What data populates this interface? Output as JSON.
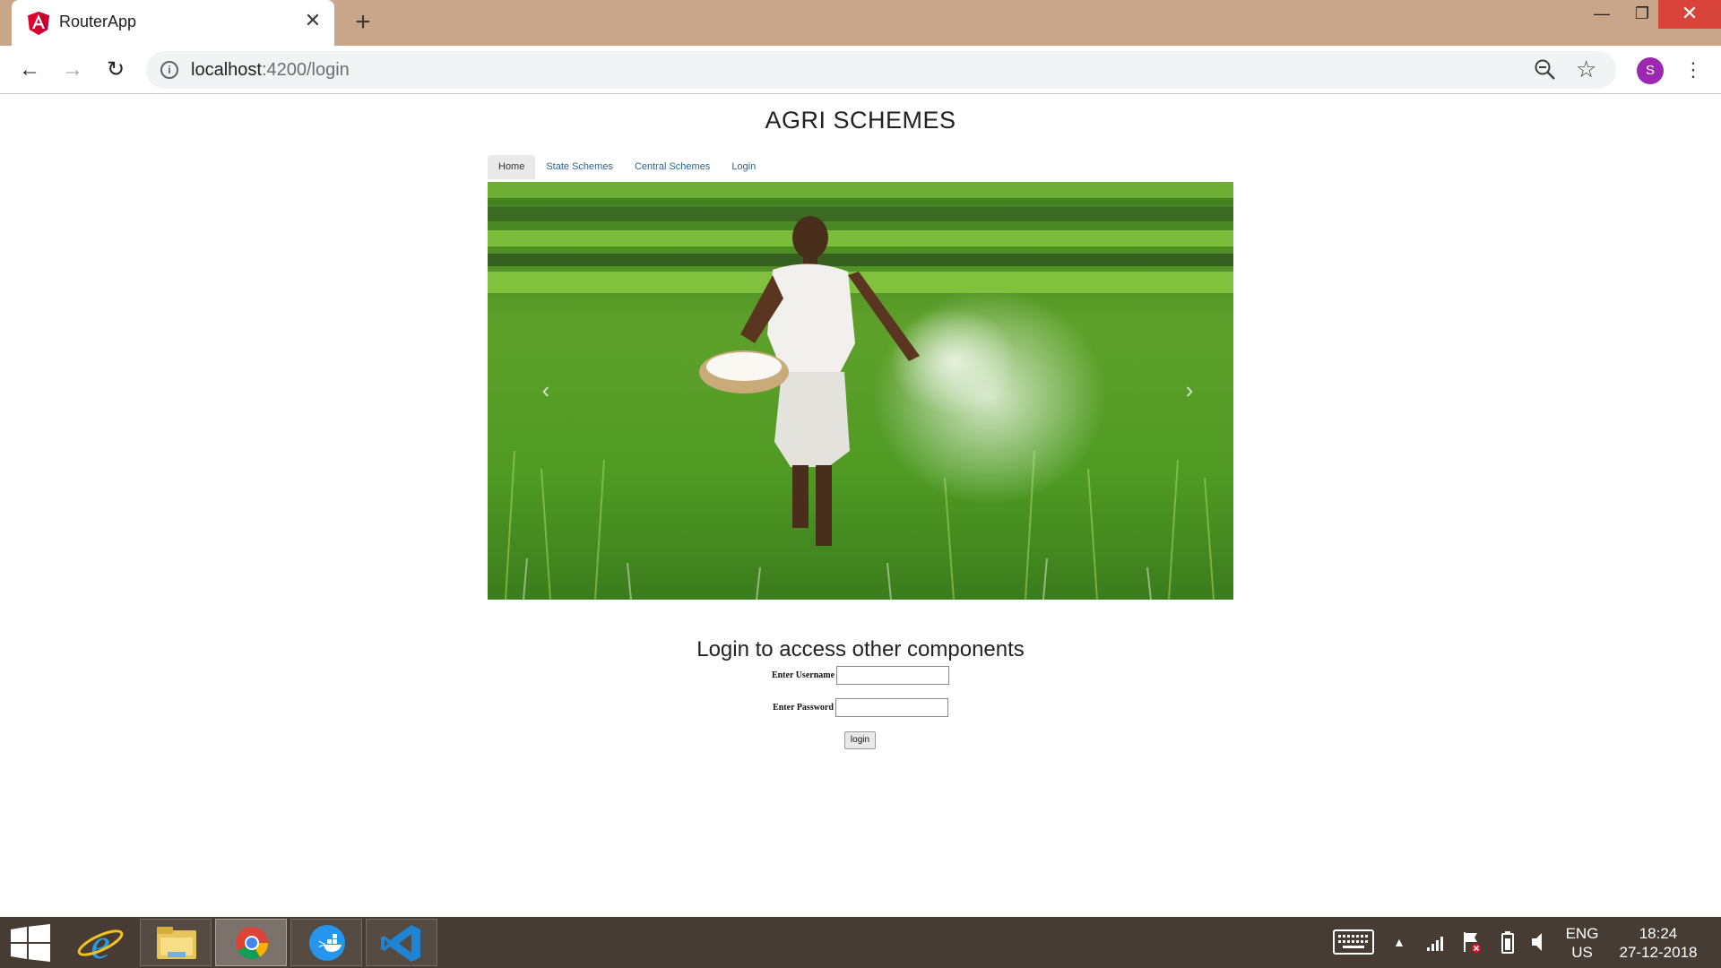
{
  "browser": {
    "tab_title": "RouterApp",
    "url_host": "localhost",
    "url_path": ":4200/login",
    "profile_initial": "S"
  },
  "page": {
    "site_title": "AGRI SCHEMES",
    "nav": [
      {
        "label": "Home",
        "active": true
      },
      {
        "label": "State Schemes",
        "active": false
      },
      {
        "label": "Central Schemes",
        "active": false
      },
      {
        "label": "Login",
        "active": false
      }
    ],
    "carousel_image": "farmer-spreading-fertilizer-in-paddy-field",
    "login_heading": "Login to access other components",
    "username_label": "Enter Username",
    "username_value": "",
    "password_label": "Enter Password",
    "password_value": "",
    "login_button": "login"
  },
  "taskbar": {
    "apps": [
      "internet-explorer-icon",
      "file-explorer-icon",
      "chrome-icon",
      "docker-icon",
      "vscode-icon"
    ],
    "active_app": "chrome-icon",
    "language_line1": "ENG",
    "language_line2": "US",
    "time": "18:24",
    "date": "27-12-2018"
  },
  "colors": {
    "tabstrip": "#c9a58a",
    "link": "#2a6496",
    "taskbar": "#473c33",
    "avatar": "#9c27b0",
    "close_button": "#d9443a"
  }
}
